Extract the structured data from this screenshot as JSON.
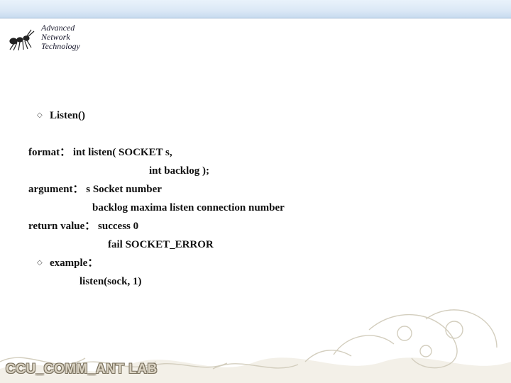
{
  "brand": {
    "l1": "Advanced",
    "l2": "Network",
    "l3": "Technology"
  },
  "section": {
    "title": "Listen()"
  },
  "lines": {
    "fmt1": "format： int listen( SOCKET s,",
    "fmt2": "int backlog );",
    "arg1": "argument： s           Socket number",
    "arg2": "backlog  maxima listen connection number",
    "ret1": "return value： success  0",
    "ret2": "fail     SOCKET_ERROR",
    "ex_label": "example：",
    "ex_code": "listen(sock, 1)"
  },
  "footer": {
    "lab": "CCU_COMM_ANT LAB"
  }
}
